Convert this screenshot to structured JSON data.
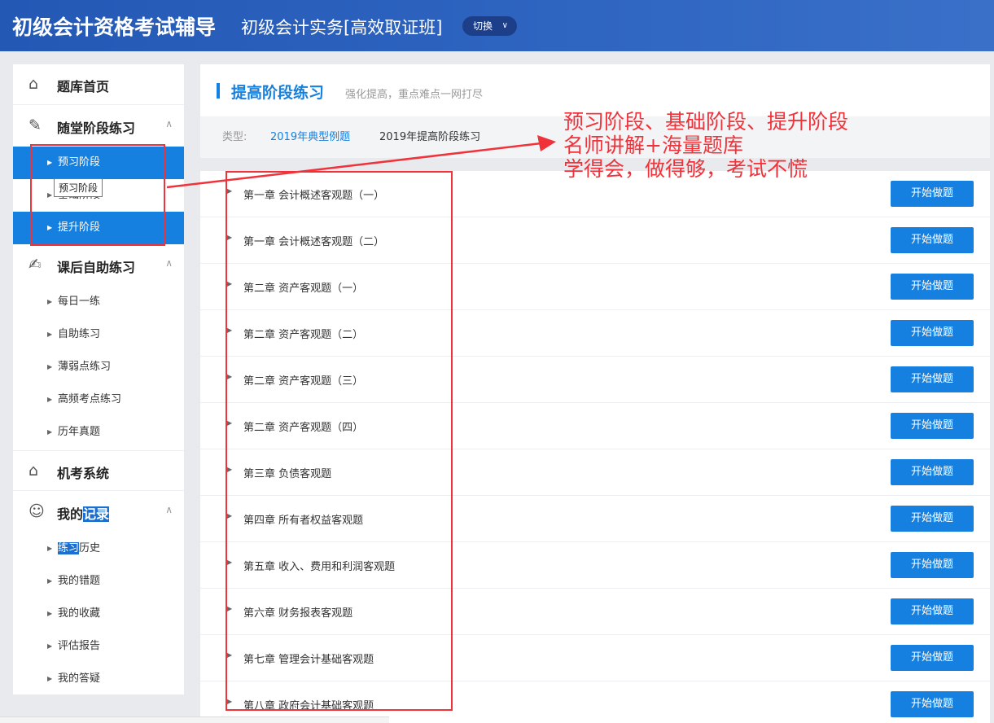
{
  "header": {
    "title": "初级会计资格考试辅导",
    "course": "初级会计实务[高效取证班]",
    "switch_label": "切换"
  },
  "sidebar": {
    "home": "题库首页",
    "stage": {
      "label": "随堂阶段练习",
      "items": [
        "预习阶段",
        "基础阶段",
        "提升阶段"
      ]
    },
    "self": {
      "label": "课后自助练习",
      "items": [
        "每日一练",
        "自助练习",
        "薄弱点练习",
        "高频考点练习",
        "历年真题"
      ]
    },
    "exam": "机考系统",
    "record": {
      "label_a": "我的",
      "label_b": "记录",
      "items_first_a": "练习",
      "items_first_b": "历史",
      "items": [
        "我的错题",
        "我的收藏",
        "评估报告",
        "我的答疑"
      ]
    }
  },
  "tooltip": "预习阶段",
  "main": {
    "title": "提高阶段练习",
    "desc": "强化提高，重点难点一网打尽",
    "filter": {
      "label": "类型:",
      "options": [
        "2019年典型例题",
        "2019年提高阶段练习"
      ]
    },
    "start_label": "开始做题",
    "chapters": [
      "第一章 会计概述客观题（一）",
      "第一章 会计概述客观题（二）",
      "第二章 资产客观题（一）",
      "第二章 资产客观题（二）",
      "第二章 资产客观题（三）",
      "第二章 资产客观题（四）",
      "第三章 负债客观题",
      "第四章 所有者权益客观题",
      "第五章 收入、费用和利润客观题",
      "第六章 财务报表客观题",
      "第七章 管理会计基础客观题",
      "第八章 政府会计基础客观题"
    ]
  },
  "annotation": {
    "lines": [
      "预习阶段、基础阶段、提升阶段",
      "名师讲解+海量题库",
      "学得会，做得够，考试不慌"
    ],
    "color": "#f0333a"
  }
}
